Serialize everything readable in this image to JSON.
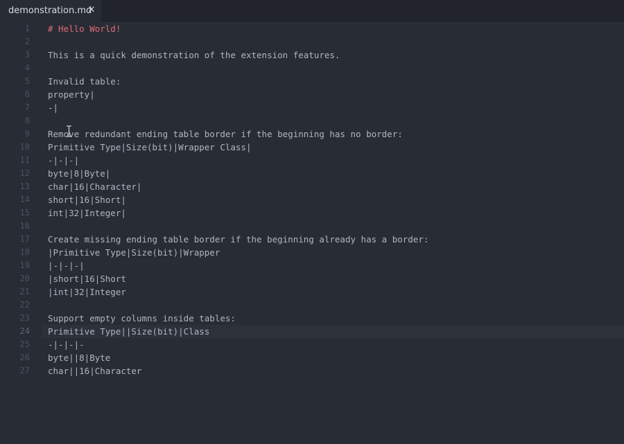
{
  "tab": {
    "title": "demonstration.md",
    "close_icon": "close-icon"
  },
  "editor": {
    "cursor_line": 24,
    "lines": [
      {
        "n": "1",
        "text": "# Hello World!",
        "kind": "heading"
      },
      {
        "n": "2",
        "text": "",
        "kind": "text"
      },
      {
        "n": "3",
        "text": "This is a quick demonstration of the extension features.",
        "kind": "text"
      },
      {
        "n": "4",
        "text": "",
        "kind": "text"
      },
      {
        "n": "5",
        "text": "Invalid table:",
        "kind": "text"
      },
      {
        "n": "6",
        "text": "property|",
        "kind": "text"
      },
      {
        "n": "7",
        "text": "-|",
        "kind": "text"
      },
      {
        "n": "8",
        "text": "",
        "kind": "text"
      },
      {
        "n": "9",
        "text": "Remove redundant ending table border if the beginning has no border:",
        "kind": "text"
      },
      {
        "n": "10",
        "text": "Primitive Type|Size(bit)|Wrapper Class|",
        "kind": "text"
      },
      {
        "n": "11",
        "text": "-|-|-|",
        "kind": "text"
      },
      {
        "n": "12",
        "text": "byte|8|Byte|",
        "kind": "text"
      },
      {
        "n": "13",
        "text": "char|16|Character|",
        "kind": "text"
      },
      {
        "n": "14",
        "text": "short|16|Short|",
        "kind": "text"
      },
      {
        "n": "15",
        "text": "int|32|Integer|",
        "kind": "text"
      },
      {
        "n": "16",
        "text": "",
        "kind": "text"
      },
      {
        "n": "17",
        "text": "Create missing ending table border if the beginning already has a border:",
        "kind": "text"
      },
      {
        "n": "18",
        "text": "|Primitive Type|Size(bit)|Wrapper",
        "kind": "text"
      },
      {
        "n": "19",
        "text": "|-|-|-|",
        "kind": "text"
      },
      {
        "n": "20",
        "text": "|short|16|Short",
        "kind": "text"
      },
      {
        "n": "21",
        "text": "|int|32|Integer",
        "kind": "text"
      },
      {
        "n": "22",
        "text": "",
        "kind": "text"
      },
      {
        "n": "23",
        "text": "Support empty columns inside tables:",
        "kind": "text"
      },
      {
        "n": "24",
        "text": "Primitive Type||Size(bit)|Class",
        "kind": "text"
      },
      {
        "n": "25",
        "text": "-|-|-|-",
        "kind": "text"
      },
      {
        "n": "26",
        "text": "byte||8|Byte",
        "kind": "text"
      },
      {
        "n": "27",
        "text": "char||16|Character",
        "kind": "text"
      }
    ]
  },
  "colors": {
    "background": "#282c34",
    "tabbar": "#21252b",
    "text": "#b0b6c0",
    "heading": "#e06c75",
    "line_number": "#4b5263"
  }
}
